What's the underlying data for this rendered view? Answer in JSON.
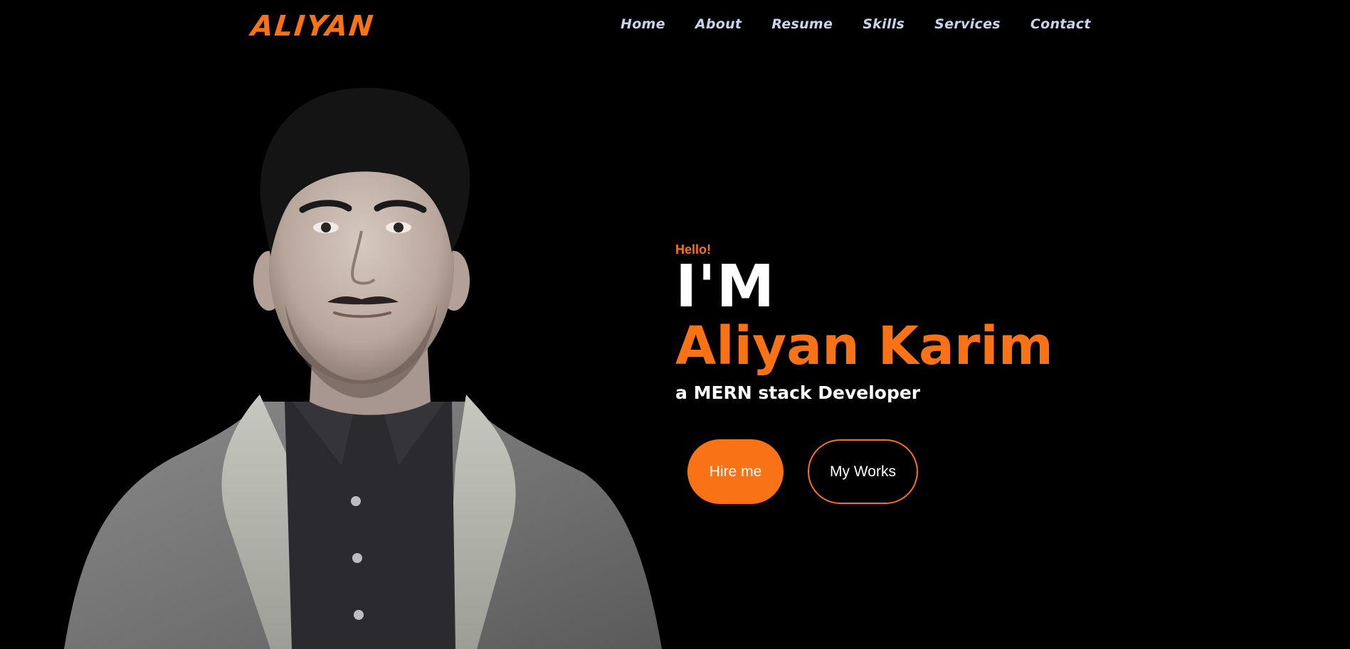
{
  "brand": {
    "logo_text": "Aliyan",
    "accent_color": "#f97316",
    "nav_color": "#c9d4ec",
    "background": "#000000"
  },
  "nav": {
    "items": [
      {
        "label": "Home"
      },
      {
        "label": "About"
      },
      {
        "label": "Resume"
      },
      {
        "label": "Skills"
      },
      {
        "label": "Services"
      },
      {
        "label": "Contact"
      }
    ]
  },
  "hero": {
    "greeting": "Hello!",
    "intro": "I'M",
    "name": "Aliyan Karim",
    "role": "a MERN stack Developer",
    "hire_button": "Hire me",
    "works_button": "My Works",
    "portrait_icon": "person-portrait-photo"
  }
}
